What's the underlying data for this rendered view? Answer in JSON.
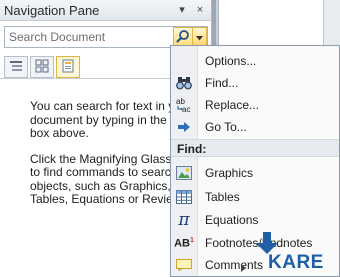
{
  "pane": {
    "title": "Navigation Pane",
    "search_placeholder": "Search Document",
    "tabs": [
      "browse-headings",
      "browse-pages",
      "browse-results"
    ],
    "help_paragraph_1": "You can search for text in your document by typing in the search box above.",
    "help_paragraph_2": "Click the Magnifying Glass button to find commands to search for objects, such as Graphics, Tables, Equations or Reviewers."
  },
  "menu": {
    "items_top": [
      {
        "label": "Options...",
        "icon": "none"
      },
      {
        "label": "Find...",
        "icon": "binoculars-icon"
      },
      {
        "label": "Replace...",
        "icon": "replace-icon"
      },
      {
        "label": "Go To...",
        "icon": "arrow-right-icon"
      }
    ],
    "section_label": "Find:",
    "items_find": [
      {
        "label": "Graphics",
        "icon": "picture-icon"
      },
      {
        "label": "Tables",
        "icon": "table-icon"
      },
      {
        "label": "Equations",
        "icon": "pi-icon"
      },
      {
        "label": "Footnotes/Endnotes",
        "icon": "footnote-icon"
      },
      {
        "label": "Comments",
        "icon": "comment-icon"
      }
    ]
  },
  "watermark": {
    "text": "KARE"
  },
  "colors": {
    "accent_yellow": "#ffdf7a",
    "menu_gutter": "#eef0f3",
    "watermark_blue": "#1e5fa8"
  }
}
